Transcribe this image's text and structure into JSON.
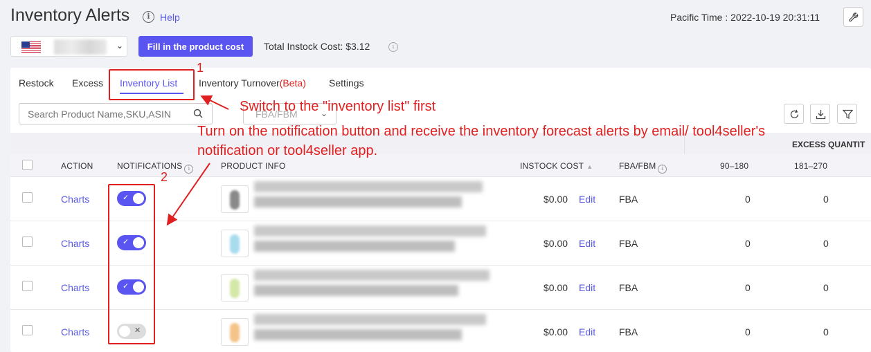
{
  "header": {
    "title": "Inventory Alerts",
    "help": "Help",
    "time": "Pacific Time : 2022-10-19 20:31:11"
  },
  "toolbar": {
    "fill_cost_button": "Fill in the product cost",
    "total_instock_cost": "Total Instock Cost: $3.12",
    "country_chevron": "⌄"
  },
  "tabs": [
    {
      "label": "Restock"
    },
    {
      "label": "Excess"
    },
    {
      "label": "Inventory List",
      "active": true
    },
    {
      "label": "Inventory Turnover",
      "suffix": "(Beta)"
    },
    {
      "label": "Settings"
    }
  ],
  "filters": {
    "search_placeholder": "Search Product Name,SKU,ASIN",
    "fulfillment_placeholder": "FBA/FBM"
  },
  "table": {
    "group_header": "EXCESS QUANTIT",
    "columns": {
      "action": "ACTION",
      "notifications": "NOTIFICATIONS",
      "product_info": "PRODUCT INFO",
      "instock_cost": "INSTOCK COST",
      "fba_fbm": "FBA/FBM",
      "range1": "90–180",
      "range2": "181–270"
    },
    "rows": [
      {
        "action": "Charts",
        "notification": "on",
        "cost": "$0.00",
        "edit": "Edit",
        "type": "FBA",
        "q1": "0",
        "q2": "0",
        "thumb_color": "#8a8a8a"
      },
      {
        "action": "Charts",
        "notification": "on",
        "cost": "$0.00",
        "edit": "Edit",
        "type": "FBA",
        "q1": "0",
        "q2": "0",
        "thumb_color": "#a8dcef"
      },
      {
        "action": "Charts",
        "notification": "on",
        "cost": "$0.00",
        "edit": "Edit",
        "type": "FBA",
        "q1": "0",
        "q2": "0",
        "thumb_color": "#d4e8a8"
      },
      {
        "action": "Charts",
        "notification": "off",
        "cost": "$0.00",
        "edit": "Edit",
        "type": "FBA",
        "q1": "0",
        "q2": "0",
        "thumb_color": "#f4c48a"
      }
    ]
  },
  "annotations": {
    "step1_number": "1",
    "step1_text": "Switch to the \"inventory list\" first",
    "step2_number": "2",
    "step2_text_line1": "Turn on the notification button and receive the inventory forecast alerts by email/ tool4seller's",
    "step2_text_line2": "notification or tool4seller app.",
    "color": "#e02020"
  }
}
